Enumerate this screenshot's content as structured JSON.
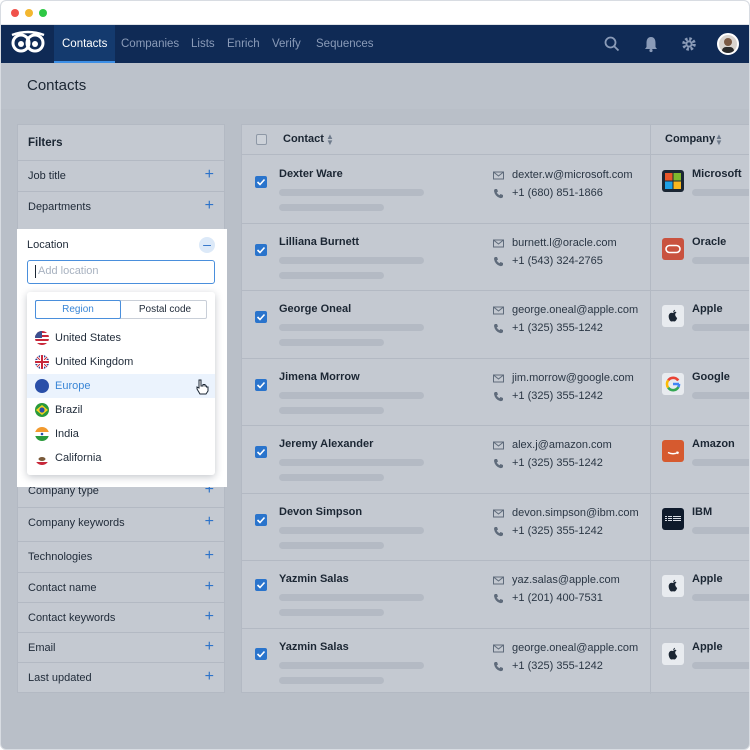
{
  "nav": {
    "items": [
      "Contacts",
      "Companies",
      "Lists",
      "Enrich",
      "Verify",
      "Sequences"
    ],
    "active": "Contacts"
  },
  "page": {
    "title": "Contacts"
  },
  "filters": {
    "header": "Filters",
    "items": [
      {
        "label": "Job title"
      },
      {
        "label": "Departments"
      },
      {
        "label": "Company type"
      },
      {
        "label": "Company keywords"
      },
      {
        "label": "Technologies"
      },
      {
        "label": "Contact name"
      },
      {
        "label": "Contact keywords"
      },
      {
        "label": "Email"
      },
      {
        "label": "Last updated"
      }
    ],
    "location": {
      "label": "Location",
      "placeholder": "Add location",
      "tabs": [
        "Region",
        "Postal code"
      ],
      "options": [
        "United States",
        "United Kingdom",
        "Europe",
        "Brazil",
        "India",
        "California"
      ],
      "highlighted": "Europe"
    }
  },
  "table": {
    "columns": {
      "contact": "Contact",
      "company": "Company"
    },
    "rows": [
      {
        "name": "Dexter Ware",
        "email": "dexter.w@microsoft.com",
        "phone": "+1 (680) 851-1866",
        "company": "Microsoft"
      },
      {
        "name": "Lilliana Burnett",
        "email": "burnett.l@oracle.com",
        "phone": "+1 (543) 324-2765",
        "company": "Oracle"
      },
      {
        "name": "George Oneal",
        "email": "george.oneal@apple.com",
        "phone": "+1 (325) 355-1242",
        "company": "Apple"
      },
      {
        "name": "Jimena Morrow",
        "email": "jim.morrow@google.com",
        "phone": "+1 (325) 355-1242",
        "company": "Google"
      },
      {
        "name": "Jeremy Alexander",
        "email": "alex.j@amazon.com",
        "phone": "+1 (325) 355-1242",
        "company": "Amazon"
      },
      {
        "name": "Devon Simpson",
        "email": "devon.simpson@ibm.com",
        "phone": "+1 (325) 355-1242",
        "company": "IBM"
      },
      {
        "name": "Yazmin Salas",
        "email": "yaz.salas@apple.com",
        "phone": "+1 (201) 400-7531",
        "company": "Apple"
      },
      {
        "name": "Yazmin Salas",
        "email": "george.oneal@apple.com",
        "phone": "+1 (325) 355-1242",
        "company": "Apple"
      }
    ]
  },
  "colors": {
    "nav_bg": "#0f2a55",
    "accent": "#2e73c9",
    "check": "#2a74cc"
  },
  "icons": [
    "search-icon",
    "bell-icon",
    "gear-icon",
    "mail-icon",
    "phone-icon",
    "plus-icon",
    "minus-icon",
    "sort-icon",
    "pointer-cursor-icon"
  ]
}
